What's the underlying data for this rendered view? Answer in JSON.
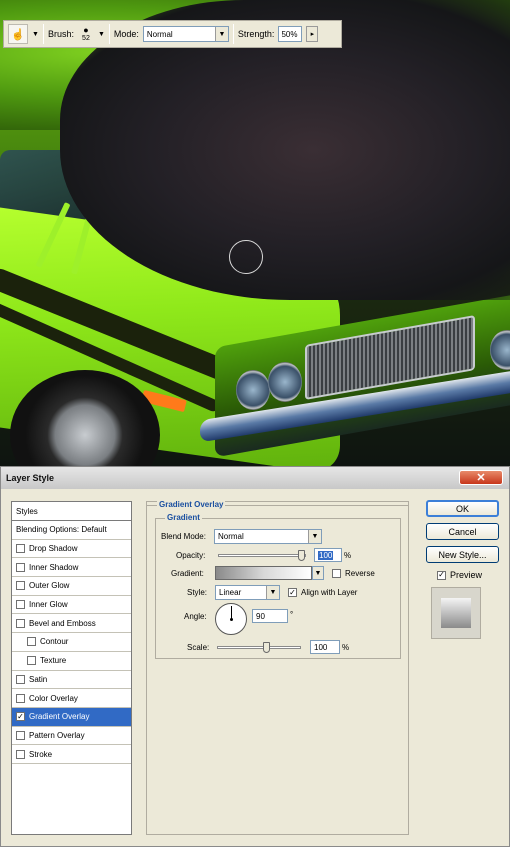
{
  "toolbar": {
    "tool_icon": "smudge-tool-icon",
    "brush_label": "Brush:",
    "brush_size": "52",
    "mode_label": "Mode:",
    "mode_value": "Normal",
    "strength_label": "Strength:",
    "strength_value": "50%"
  },
  "dialog": {
    "title": "Layer Style",
    "styles_header": "Styles",
    "blending_options": "Blending Options: Default",
    "effects": [
      {
        "label": "Drop Shadow",
        "checked": false
      },
      {
        "label": "Inner Shadow",
        "checked": false
      },
      {
        "label": "Outer Glow",
        "checked": false
      },
      {
        "label": "Inner Glow",
        "checked": false
      },
      {
        "label": "Bevel and Emboss",
        "checked": false
      },
      {
        "label": "Contour",
        "checked": false
      },
      {
        "label": "Texture",
        "checked": false
      },
      {
        "label": "Satin",
        "checked": false
      },
      {
        "label": "Color Overlay",
        "checked": false
      },
      {
        "label": "Gradient Overlay",
        "checked": true
      },
      {
        "label": "Pattern Overlay",
        "checked": false
      },
      {
        "label": "Stroke",
        "checked": false
      }
    ],
    "panel_title": "Gradient Overlay",
    "group_title": "Gradient",
    "blend_mode_label": "Blend Mode:",
    "blend_mode_value": "Normal",
    "opacity_label": "Opacity:",
    "opacity_value": "100",
    "opacity_unit": "%",
    "gradient_label": "Gradient:",
    "reverse_label": "Reverse",
    "reverse_checked": false,
    "style_label": "Style:",
    "style_value": "Linear",
    "align_label": "Align with Layer",
    "align_checked": true,
    "angle_label": "Angle:",
    "angle_value": "90",
    "angle_unit": "°",
    "scale_label": "Scale:",
    "scale_value": "100",
    "scale_unit": "%",
    "opacity_slider_fraction": 1.0,
    "scale_slider_fraction": 0.6,
    "ok_label": "OK",
    "cancel_label": "Cancel",
    "new_style_label": "New Style...",
    "preview_label": "Preview",
    "preview_checked": true,
    "close_label": "✕"
  }
}
